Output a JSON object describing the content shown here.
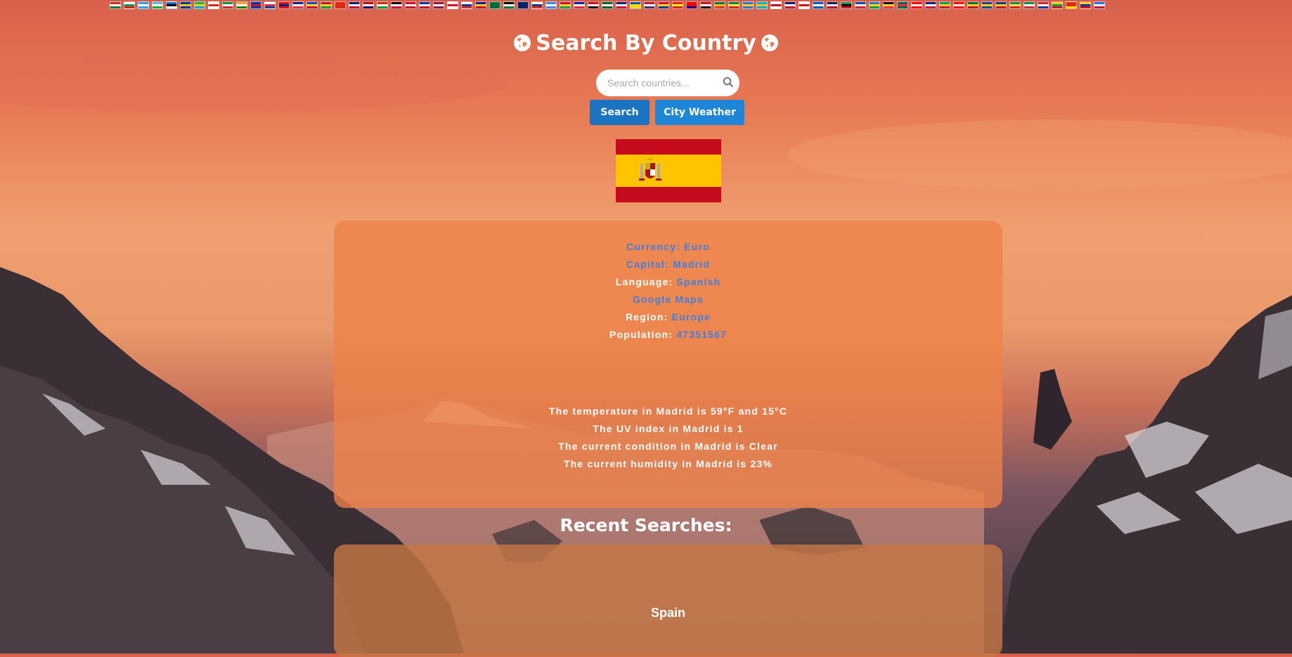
{
  "header": {
    "title": "Search By Country",
    "globe_icon": "globe-icon"
  },
  "search": {
    "placeholder": "Search countries...",
    "value": "",
    "icon": "search-icon",
    "search_button": "Search",
    "weather_button": "City Weather"
  },
  "flag_strip": {
    "colors": [
      [
        "#d52b1e",
        "#fff",
        "#007a3d"
      ],
      [
        "#fff",
        "#00966e",
        "#d62612"
      ],
      [
        "#3aa0dc",
        "#fff",
        "#3aa0dc"
      ],
      [
        "#6ab2e7",
        "#fff",
        "#12ad2b"
      ],
      [
        "#0072ce",
        "#000",
        "#fff"
      ],
      [
        "#003399",
        "#ffcc00",
        "#003399"
      ],
      [
        "#1eb53a",
        "#fcd116",
        "#00a3dd"
      ],
      [
        "#fff",
        "#d52b1e",
        "#fff"
      ],
      [
        "#009246",
        "#fff",
        "#ce2b37"
      ],
      [
        "#ff9933",
        "#fff",
        "#138808"
      ],
      [
        "#0038a8",
        "#ce1126",
        "#0038a8"
      ],
      [
        "#fff",
        "#cd2e3a",
        "#0047a0"
      ],
      [
        "#ce1126",
        "#002868",
        "#ce1126"
      ],
      [
        "#002395",
        "#fff",
        "#ed2939"
      ],
      [
        "#0052b4",
        "#ffda44",
        "#d80027"
      ],
      [
        "#ce1126",
        "#fcd116",
        "#009e49"
      ],
      [
        "#de2910",
        "#de2910",
        "#de2910"
      ],
      [
        "#012169",
        "#fff",
        "#c8102e"
      ],
      [
        "#cc0001",
        "#fff",
        "#010066"
      ],
      [
        "#d62612",
        "#fff",
        "#009a44"
      ],
      [
        "#000",
        "#fff",
        "#d21034"
      ],
      [
        "#ce1126",
        "#fff",
        "#ce1126"
      ],
      [
        "#0038a8",
        "#fff",
        "#ce1126"
      ],
      [
        "#8d1b3d",
        "#fff",
        "#8d1b3d"
      ],
      [
        "#fff",
        "#d80027",
        "#fff"
      ],
      [
        "#fff",
        "#0039a6",
        "#d52b1e"
      ],
      [
        "#002395",
        "#fcd116",
        "#ce1126"
      ],
      [
        "#006c35",
        "#006c35",
        "#006c35"
      ],
      [
        "#000",
        "#fff",
        "#007a3d"
      ],
      [
        "#012169",
        "#012169",
        "#012169"
      ],
      [
        "#fff",
        "#003f87",
        "#d52b1e"
      ],
      [
        "#4189dd",
        "#fff",
        "#4189dd"
      ],
      [
        "#d21034",
        "#fcd116",
        "#009e60"
      ],
      [
        "#002395",
        "#fff",
        "#ed2939"
      ],
      [
        "#ce1126",
        "#fff",
        "#000"
      ],
      [
        "#006233",
        "#fff",
        "#006233"
      ],
      [
        "#00247d",
        "#fff",
        "#cf142b"
      ],
      [
        "#0057b7",
        "#ffd700",
        "#ffd700"
      ],
      [
        "#b22234",
        "#fff",
        "#3c3b6e"
      ],
      [
        "#ce1126",
        "#fcd116",
        "#0038a8"
      ],
      [
        "#da251d",
        "#ffff00",
        "#da251d"
      ],
      [
        "#fe0000",
        "#fe0000",
        "#000095"
      ],
      [
        "#ce1126",
        "#fff",
        "#000"
      ],
      [
        "#007a4d",
        "#ffb612",
        "#de3831"
      ],
      [
        "#00853f",
        "#fdef42",
        "#e31b23"
      ],
      [
        "#3a75c4",
        "#fcd116",
        "#3a75c4"
      ],
      [
        "#00afca",
        "#fec50c",
        "#00afca"
      ],
      [
        "#fff",
        "#bc002d",
        "#fff"
      ],
      [
        "#012169",
        "#fff",
        "#c8102e"
      ],
      [
        "#fff",
        "#ce1124",
        "#fff"
      ],
      [
        "#005eb8",
        "#fff",
        "#005eb8"
      ],
      [
        "#00205b",
        "#fff",
        "#ba0c2f"
      ],
      [
        "#009e49",
        "#000",
        "#ce1126"
      ],
      [
        "#024fa2",
        "#fff",
        "#ed1c27"
      ],
      [
        "#3a75c4",
        "#fcd116",
        "#009e49"
      ],
      [
        "#000",
        "#fdda24",
        "#ef3340"
      ],
      [
        "#006a4e",
        "#f42a41",
        "#006a4e"
      ],
      [
        "#ff0000",
        "#fff",
        "#ff0000"
      ],
      [
        "#00247d",
        "#fff",
        "#cf142b"
      ],
      [
        "#009e60",
        "#fcd116",
        "#d21034"
      ],
      [
        "#ff0000",
        "#fff",
        "#ff0000"
      ],
      [
        "#006b3f",
        "#fcd116",
        "#ce1126"
      ],
      [
        "#21468b",
        "#f7d116",
        "#21468b"
      ],
      [
        "#003893",
        "#fcd116",
        "#ce1126"
      ],
      [
        "#009543",
        "#fbde4a",
        "#dc241f"
      ],
      [
        "#009246",
        "#fff",
        "#ce2b37"
      ],
      [
        "#d52b1e",
        "#fff",
        "#0039a6"
      ],
      [
        "#fcd116",
        "#009e49",
        "#ce1126"
      ],
      [
        "#de2910",
        "#de2910",
        "#ffde00"
      ],
      [
        "#fcd116",
        "#003893",
        "#ce1126"
      ],
      [
        "#1a75ff",
        "#fff",
        "#ce1126"
      ]
    ]
  },
  "country": {
    "flag_name": "spain-flag-image",
    "currency_label": "Currency:",
    "currency_value": "Euro",
    "capital_label": "Capital:",
    "capital_value": "Madrid",
    "language_label": "Language:",
    "language_value": "Spanish",
    "maps_link": "Google Maps",
    "region_label": "Region:",
    "region_value": "Europe",
    "population_label": "Population:",
    "population_value": "47351567"
  },
  "weather": {
    "temperature": "The temperature in Madrid is 59°F and 15°C",
    "uv": "The UV index in Madrid is 1",
    "condition": "The current condition in Madrid is Clear",
    "humidity": "The current humidity in Madrid is 23%"
  },
  "recent": {
    "title": "Recent Searches:",
    "items": [
      "Spain"
    ]
  }
}
